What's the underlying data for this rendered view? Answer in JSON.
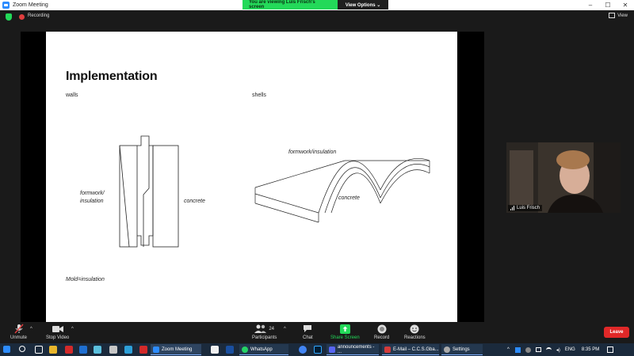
{
  "window": {
    "title": "Zoom Meeting"
  },
  "banner": {
    "viewing": "You are viewing Luis Frisch's screen",
    "view_options": "View Options ⌄"
  },
  "meeting": {
    "recording": "Recording",
    "view": "View"
  },
  "slide": {
    "title": "Implementation",
    "walls_label": "walls",
    "shells_label": "shells",
    "formwork_label_1": "formwork/",
    "formwork_label_2": "insulation",
    "concrete_label": "concrete",
    "shell_formwork_label": "formwork/insulation",
    "shell_concrete_label": "concrete",
    "footnote": "Mold=insulation"
  },
  "participant": {
    "name": "Luis Frisch"
  },
  "toolbar": {
    "unmute": "Unmute",
    "stop_video": "Stop Video",
    "participants": "Participants",
    "participants_count": "24",
    "chat": "Chat",
    "share_screen": "Share Screen",
    "record": "Record",
    "reactions": "Reactions",
    "leave": "Leave"
  },
  "taskbar": {
    "apps": [
      {
        "label": "Zoom Meeting"
      },
      {
        "label": "WhatsApp"
      },
      {
        "label": "announcements - ..."
      },
      {
        "label": "E-Mail – C.C.S.Gba..."
      },
      {
        "label": "Settings"
      }
    ],
    "language": "ENG",
    "time": "8:35 PM"
  },
  "colors": {
    "zoom_blue": "#2d8cff",
    "banner_green": "#23d959",
    "leave_red": "#e02828",
    "taskbar": "#1b2a3c"
  }
}
